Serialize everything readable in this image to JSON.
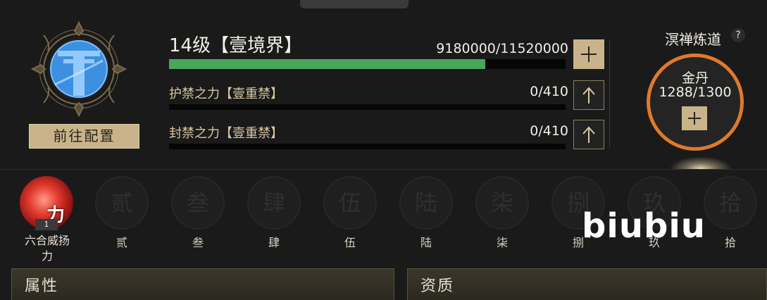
{
  "realm": {
    "level_title": "14级【壹境界】",
    "exp_text": "9180000/11520000",
    "exp_progress": 0.797
  },
  "config_button": "前往配置",
  "bars": [
    {
      "label": "护禁之力【壹重禁】",
      "value_text": "0/410",
      "progress": 0
    },
    {
      "label": "封禁之力【壹重禁】",
      "value_text": "0/410",
      "progress": 0
    }
  ],
  "dao": {
    "title": "溟禅炼道",
    "help": "?",
    "item_name": "金丹",
    "item_value": "1288/1300"
  },
  "skills": {
    "active": {
      "label_line1": "六合威扬",
      "label_line2": "力",
      "icon_char": "力",
      "badge": "1"
    },
    "slots": [
      {
        "glyph": "贰",
        "label": "贰"
      },
      {
        "glyph": "叁",
        "label": "叁"
      },
      {
        "glyph": "肆",
        "label": "肆"
      },
      {
        "glyph": "伍",
        "label": "伍"
      },
      {
        "glyph": "陆",
        "label": "陆"
      },
      {
        "glyph": "柒",
        "label": "柒"
      },
      {
        "glyph": "捌",
        "label": "捌"
      },
      {
        "glyph": "玖",
        "label": "玖"
      },
      {
        "glyph": "拾",
        "label": "拾"
      }
    ]
  },
  "watermark": "biubiu",
  "sections": [
    {
      "title": "属性"
    },
    {
      "title": "资质"
    }
  ],
  "colors": {
    "accent_gold": "#c9b38a",
    "exp_green": "#4aa65a",
    "ring_orange": "#e0792c",
    "active_red": "#e23b2e"
  }
}
